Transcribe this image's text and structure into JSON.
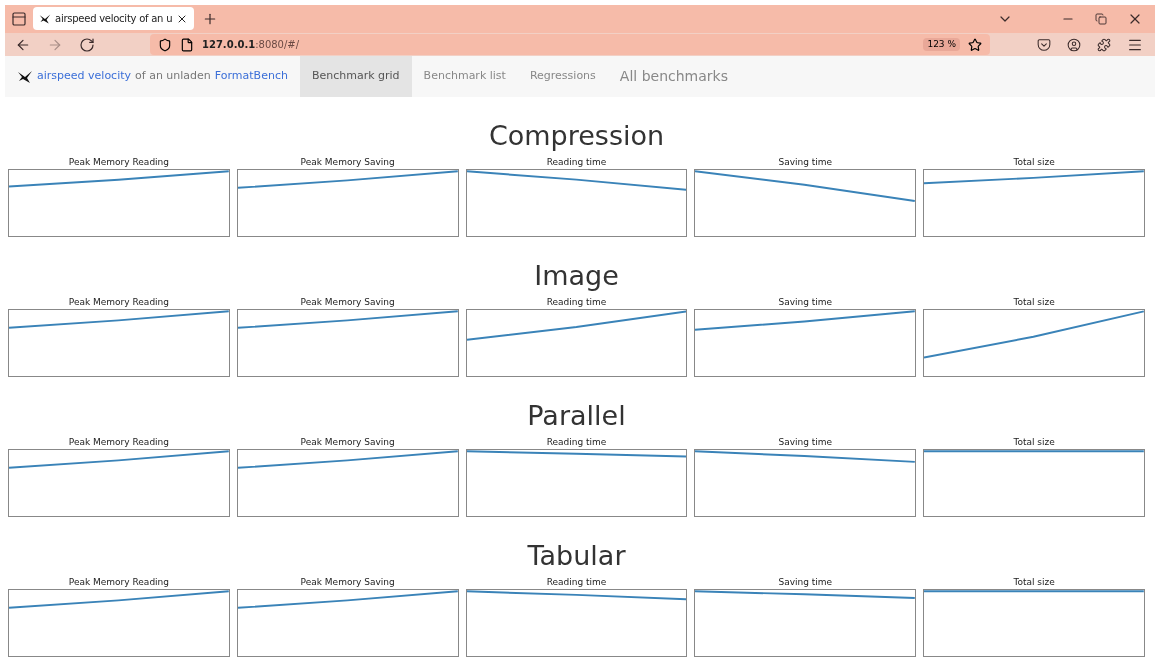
{
  "browser": {
    "tab_title": "airspeed velocity of an u",
    "url_host": "127.0.0.1",
    "url_path": ":8080/#/",
    "zoom": "123 %"
  },
  "navbar": {
    "brand": [
      {
        "text": "airspeed velocity",
        "kind": "link"
      },
      {
        "text": "of an unladen",
        "kind": "plain"
      },
      {
        "text": "FormatBench",
        "kind": "link"
      }
    ],
    "tabs": [
      {
        "label": "Benchmark grid",
        "selected": true,
        "kind": "tab"
      },
      {
        "label": "Benchmark list",
        "selected": false,
        "kind": "tab"
      },
      {
        "label": "Regressions",
        "selected": false,
        "kind": "tab"
      },
      {
        "label": "All benchmarks",
        "selected": false,
        "kind": "large"
      }
    ]
  },
  "sections": [
    {
      "title": "Compression",
      "charts": [
        "Peak Memory Reading",
        "Peak Memory Saving",
        "Reading time",
        "Saving time",
        "Total size"
      ]
    },
    {
      "title": "Image",
      "charts": [
        "Peak Memory Reading",
        "Peak Memory Saving",
        "Reading time",
        "Saving time",
        "Total size"
      ]
    },
    {
      "title": "Parallel",
      "charts": [
        "Peak Memory Reading",
        "Peak Memory Saving",
        "Reading time",
        "Saving time",
        "Total size"
      ]
    },
    {
      "title": "Tabular",
      "charts": [
        "Peak Memory Reading",
        "Peak Memory Saving",
        "Reading time",
        "Saving time",
        "Total size"
      ]
    }
  ]
}
